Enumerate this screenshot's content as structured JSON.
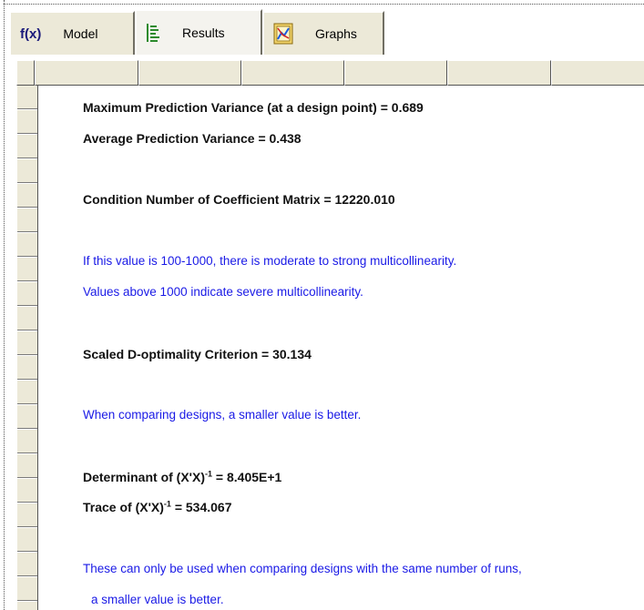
{
  "tabs": {
    "model": {
      "icon_text": "f(x)",
      "label": "Model"
    },
    "results": {
      "label": "Results"
    },
    "graphs": {
      "label": "Graphs"
    }
  },
  "results": {
    "max_pred_var": "Maximum Prediction Variance (at a design point) =  0.689",
    "avg_pred_var": "Average Prediction Variance  =  0.438",
    "condition_number": "Condition Number of Coefficient Matrix = 12220.010",
    "cond_note_1": "If this value is 100-1000, there is moderate to strong multicollinearity.",
    "cond_note_2": "Values above 1000 indicate severe multicollinearity.",
    "d_optimality": "Scaled D-optimality Criterion =  30.134",
    "d_opt_note": "When comparing designs, a smaller value is better.",
    "determinant_prefix": "Determinant of (X'X)",
    "determinant_sup": "-1",
    "determinant_value": " = 8.405E+1",
    "trace_prefix": "Trace of (X'X)",
    "trace_sup": "-1",
    "trace_value": " = 534.067",
    "runs_note_1": "These can only be used when comparing designs with the same number of runs,",
    "runs_note_2": "a smaller value is better."
  },
  "colors": {
    "note_text": "#1a1ae6",
    "tab_face": "#ece9d8",
    "grid_header": "#ece9d8"
  },
  "icons": {
    "model": "function-fx-icon",
    "results": "results-list-icon",
    "graphs": "graph-icon"
  }
}
